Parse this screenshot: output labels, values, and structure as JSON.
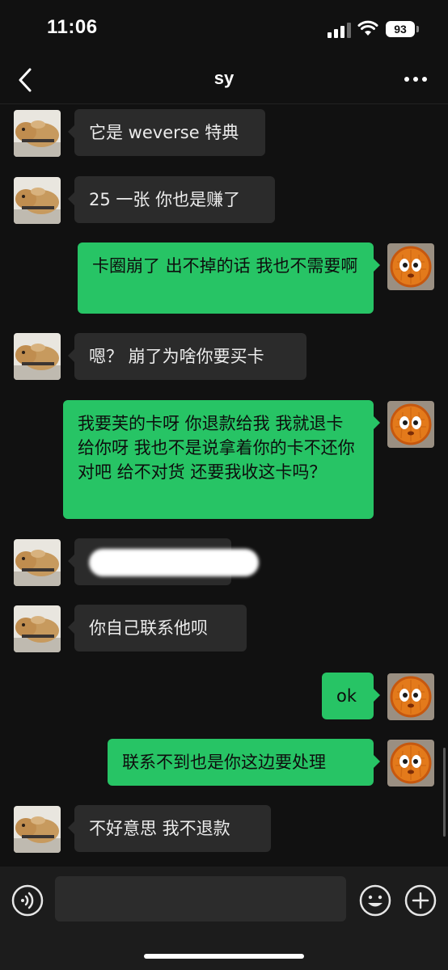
{
  "status_bar": {
    "time": "11:06",
    "battery": "93",
    "icons": [
      "signal-icon",
      "wifi-icon",
      "battery-icon"
    ]
  },
  "header": {
    "title": "sy",
    "back_icon": "chevron-left-icon",
    "more_icon": "more-dots-icon"
  },
  "messages": [
    {
      "side": "left",
      "text": "它是 weverse 特典"
    },
    {
      "side": "left",
      "text": "25 一张 你也是赚了"
    },
    {
      "side": "right",
      "text": "卡圈崩了 出不掉的话 我也不需要啊"
    },
    {
      "side": "left",
      "text": "嗯？ 崩了为啥你要买卡"
    },
    {
      "side": "right",
      "text": "我要芙的卡呀 你退款给我 我就退卡给你呀 我也不是说拿着你的卡不还你对吧 给不对货 还要我收这卡吗？"
    },
    {
      "side": "left",
      "text": ""
    },
    {
      "side": "left",
      "text": "你自己联系他呗"
    },
    {
      "side": "right",
      "text": "ok"
    },
    {
      "side": "right",
      "text": "联系不到也是你这边要处理"
    },
    {
      "side": "left",
      "text": "不好意思 我不退款"
    }
  ],
  "input_bar": {
    "value": "",
    "icons": [
      "voice-icon",
      "emoji-icon",
      "plus-icon"
    ]
  },
  "colors": {
    "background": "#111111",
    "incoming_bubble": "#2b2b2b",
    "outgoing_bubble": "#27c465"
  }
}
